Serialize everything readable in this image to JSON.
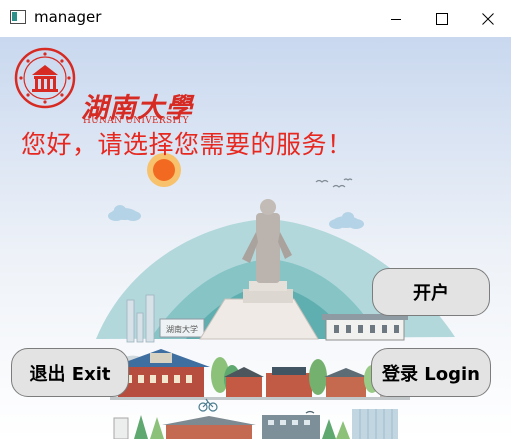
{
  "window": {
    "title": "manager",
    "controls": {
      "minimize_icon": "minimize-icon",
      "maximize_icon": "maximize-icon",
      "close_icon": "close-icon"
    }
  },
  "brand": {
    "name_cn": "湖南大學",
    "name_en": "HUNAN UNIVERSITY",
    "color": "#d62a22"
  },
  "greeting": "您好，请选择您需要的服务！",
  "buttons": {
    "open_account": "开户",
    "exit": "退出 Exit",
    "login": "登录 Login"
  },
  "theme": {
    "heading_color": "#e62820",
    "button_bg": "#e3e3e3",
    "sky_top": "#c9d8ef"
  }
}
